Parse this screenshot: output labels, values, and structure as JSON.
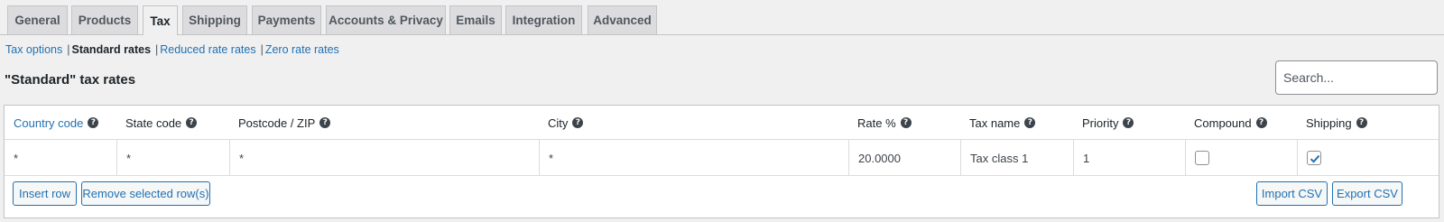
{
  "tabs": [
    {
      "label": "General",
      "active": false
    },
    {
      "label": "Products",
      "active": false
    },
    {
      "label": "Tax",
      "active": true
    },
    {
      "label": "Shipping",
      "active": false
    },
    {
      "label": "Payments",
      "active": false
    },
    {
      "label": "Accounts & Privacy",
      "active": false
    },
    {
      "label": "Emails",
      "active": false
    },
    {
      "label": "Integration",
      "active": false
    },
    {
      "label": "Advanced",
      "active": false
    }
  ],
  "subnav": {
    "tax_options": "Tax options",
    "sep": "|",
    "standard_rates": "Standard rates",
    "reduced_rates": "Reduced rate rates",
    "zero_rates": "Zero rate rates"
  },
  "heading": "\"Standard\" tax rates",
  "search": {
    "placeholder": "Search...",
    "value": ""
  },
  "columns": [
    "Country code",
    "State code",
    "Postcode / ZIP",
    "City",
    "Rate %",
    "Tax name",
    "Priority",
    "Compound",
    "Shipping"
  ],
  "help_glyph": "?",
  "row": {
    "country": "*",
    "state": "*",
    "postcode": "*",
    "city": "*",
    "rate": "20.0000",
    "tax_name": "Tax class 1",
    "priority": "1",
    "compound": false,
    "shipping": true
  },
  "buttons": {
    "insert_row": "Insert row",
    "remove_rows": "Remove selected row(s)",
    "import_csv": "Import CSV",
    "export_csv": "Export CSV"
  },
  "colors": {
    "accent": "#2271b1",
    "background": "#f0f0f1"
  }
}
